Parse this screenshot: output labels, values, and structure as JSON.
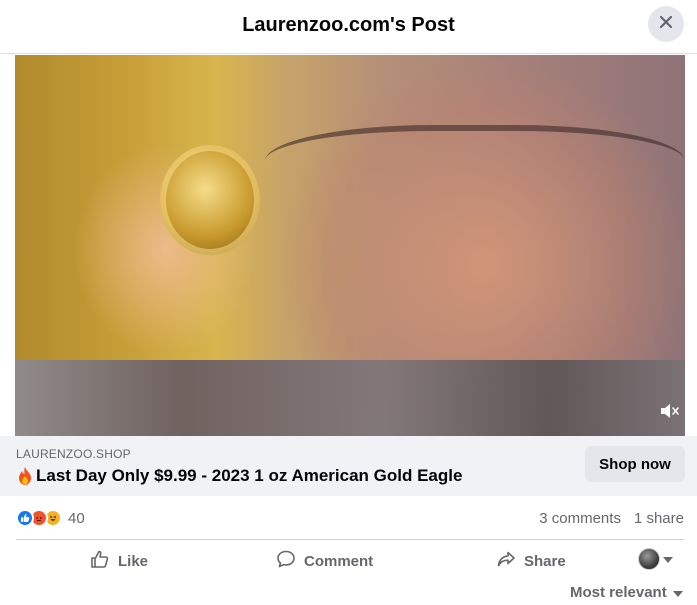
{
  "header": {
    "title": "Laurenzoo.com's Post",
    "close_icon": "close-icon"
  },
  "video": {
    "mute_icon": "volume-muted-icon"
  },
  "ad": {
    "domain": "LAURENZOO.SHOP",
    "headline_icon": "fire-emoji",
    "headline": "Last Day Only $9.99 - 2023 1 oz American Gold Eagle",
    "cta_label": "Shop now"
  },
  "stats": {
    "reactions": [
      "like",
      "angry",
      "haha"
    ],
    "reaction_count": "40",
    "comments": "3 comments",
    "shares": "1 share"
  },
  "actions": {
    "like": "Like",
    "comment": "Comment",
    "share": "Share"
  },
  "comments": {
    "sort_label": "Most relevant"
  },
  "colors": {
    "accent": "#1877f2",
    "secondary_text": "#65676b",
    "button_bg": "#e4e6eb",
    "ad_bar_bg": "#f0f2f5"
  }
}
